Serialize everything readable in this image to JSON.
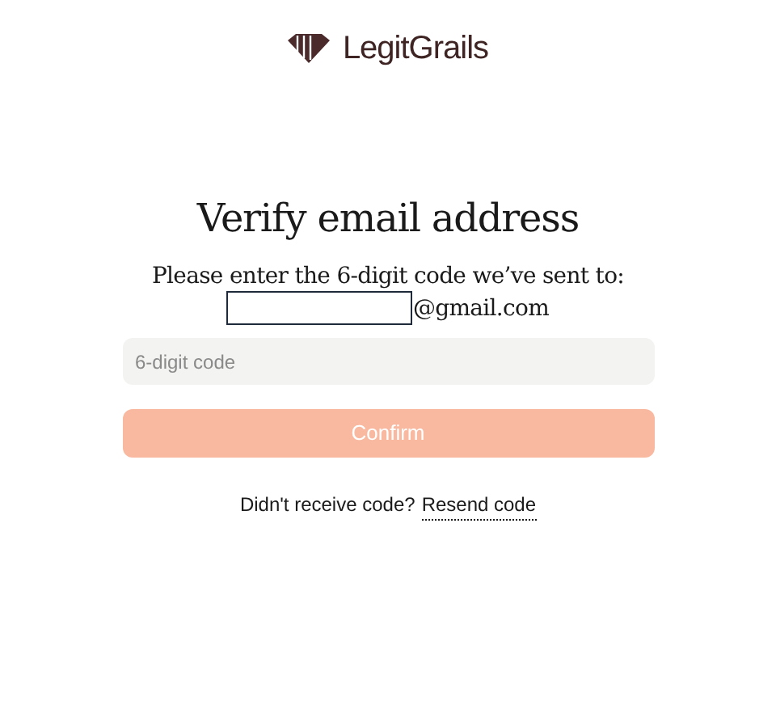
{
  "brand": {
    "name": "LegitGrails"
  },
  "title": "Verify email address",
  "instruction": "Please enter the 6-digit code we’ve sent to:",
  "email_suffix": "@gmail.com",
  "code_field": {
    "placeholder": "6-digit code"
  },
  "confirm_button": {
    "label": "Confirm",
    "disabled": true
  },
  "resend": {
    "prompt": "Didn't receive code?",
    "link": "Resend code"
  }
}
